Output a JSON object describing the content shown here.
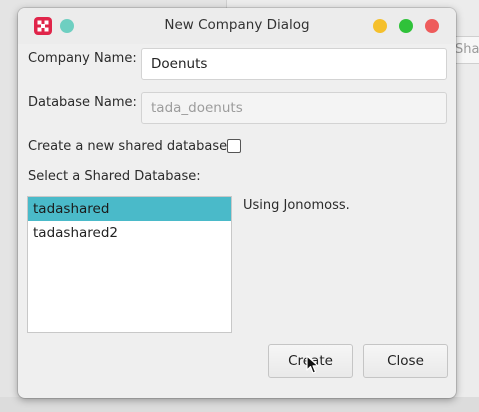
{
  "background": {
    "field_hint": "Shar"
  },
  "dialog": {
    "title": "New Company Dialog",
    "company_name_label": "Company Name:",
    "company_name_value": "Doenuts",
    "database_name_label": "Database Name:",
    "database_name_placeholder": "tada_doenuts",
    "create_shared_label": "Create a new shared database?",
    "create_shared_checked": false,
    "select_shared_label": "Select a Shared Database:",
    "shared_databases": [
      "tadashared",
      "tadashared2"
    ],
    "selected_database": "tadashared",
    "status_text": "Using Jonomoss.",
    "create_button": "Create",
    "close_button": "Close"
  },
  "colors": {
    "accent_selection": "#4abac9",
    "menu_dot": "#6ecfc1",
    "minimize": "#f5c02c",
    "maximize": "#2fc23a",
    "close": "#ee5b5b"
  },
  "icons": {
    "app": "grid-app-icon",
    "menu": "menu-dot-icon",
    "cursor": "mouse-pointer-icon"
  }
}
